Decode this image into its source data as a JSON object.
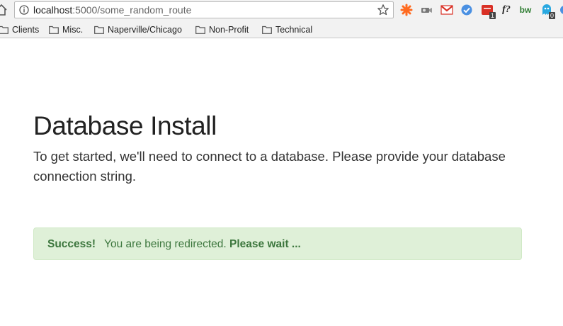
{
  "browser": {
    "url_host": "localhost",
    "url_path": ":5000/some_random_route",
    "extensions": [
      {
        "name": "zapier-icon",
        "color": "#ff6a1f"
      },
      {
        "name": "camera-extension-icon"
      },
      {
        "name": "gmail-icon",
        "color": "#d93025"
      },
      {
        "name": "check-extension-icon",
        "color": "#4a90e2"
      },
      {
        "name": "red-extension-icon",
        "badge": "1",
        "color": "#d93025"
      },
      {
        "name": "fonts-extension-icon",
        "text": "f?"
      },
      {
        "name": "bw-extension-icon",
        "text": "bw",
        "color": "#2e7d32"
      },
      {
        "name": "ghostery-icon",
        "badge": "0",
        "color": "#29a8e0"
      }
    ]
  },
  "bookmarks": [
    {
      "label": "Clients"
    },
    {
      "label": "Misc."
    },
    {
      "label": "Naperville/Chicago"
    },
    {
      "label": "Non-Profit"
    },
    {
      "label": "Technical"
    }
  ],
  "page": {
    "title": "Database Install",
    "lead": "To get started, we'll need to connect to a database. Please provide your database connection string."
  },
  "alert": {
    "label": "Success!",
    "message": "You are being redirected.",
    "emphasis": "Please wait ...",
    "color_bg": "#dff0d8",
    "color_text": "#3c763d"
  }
}
